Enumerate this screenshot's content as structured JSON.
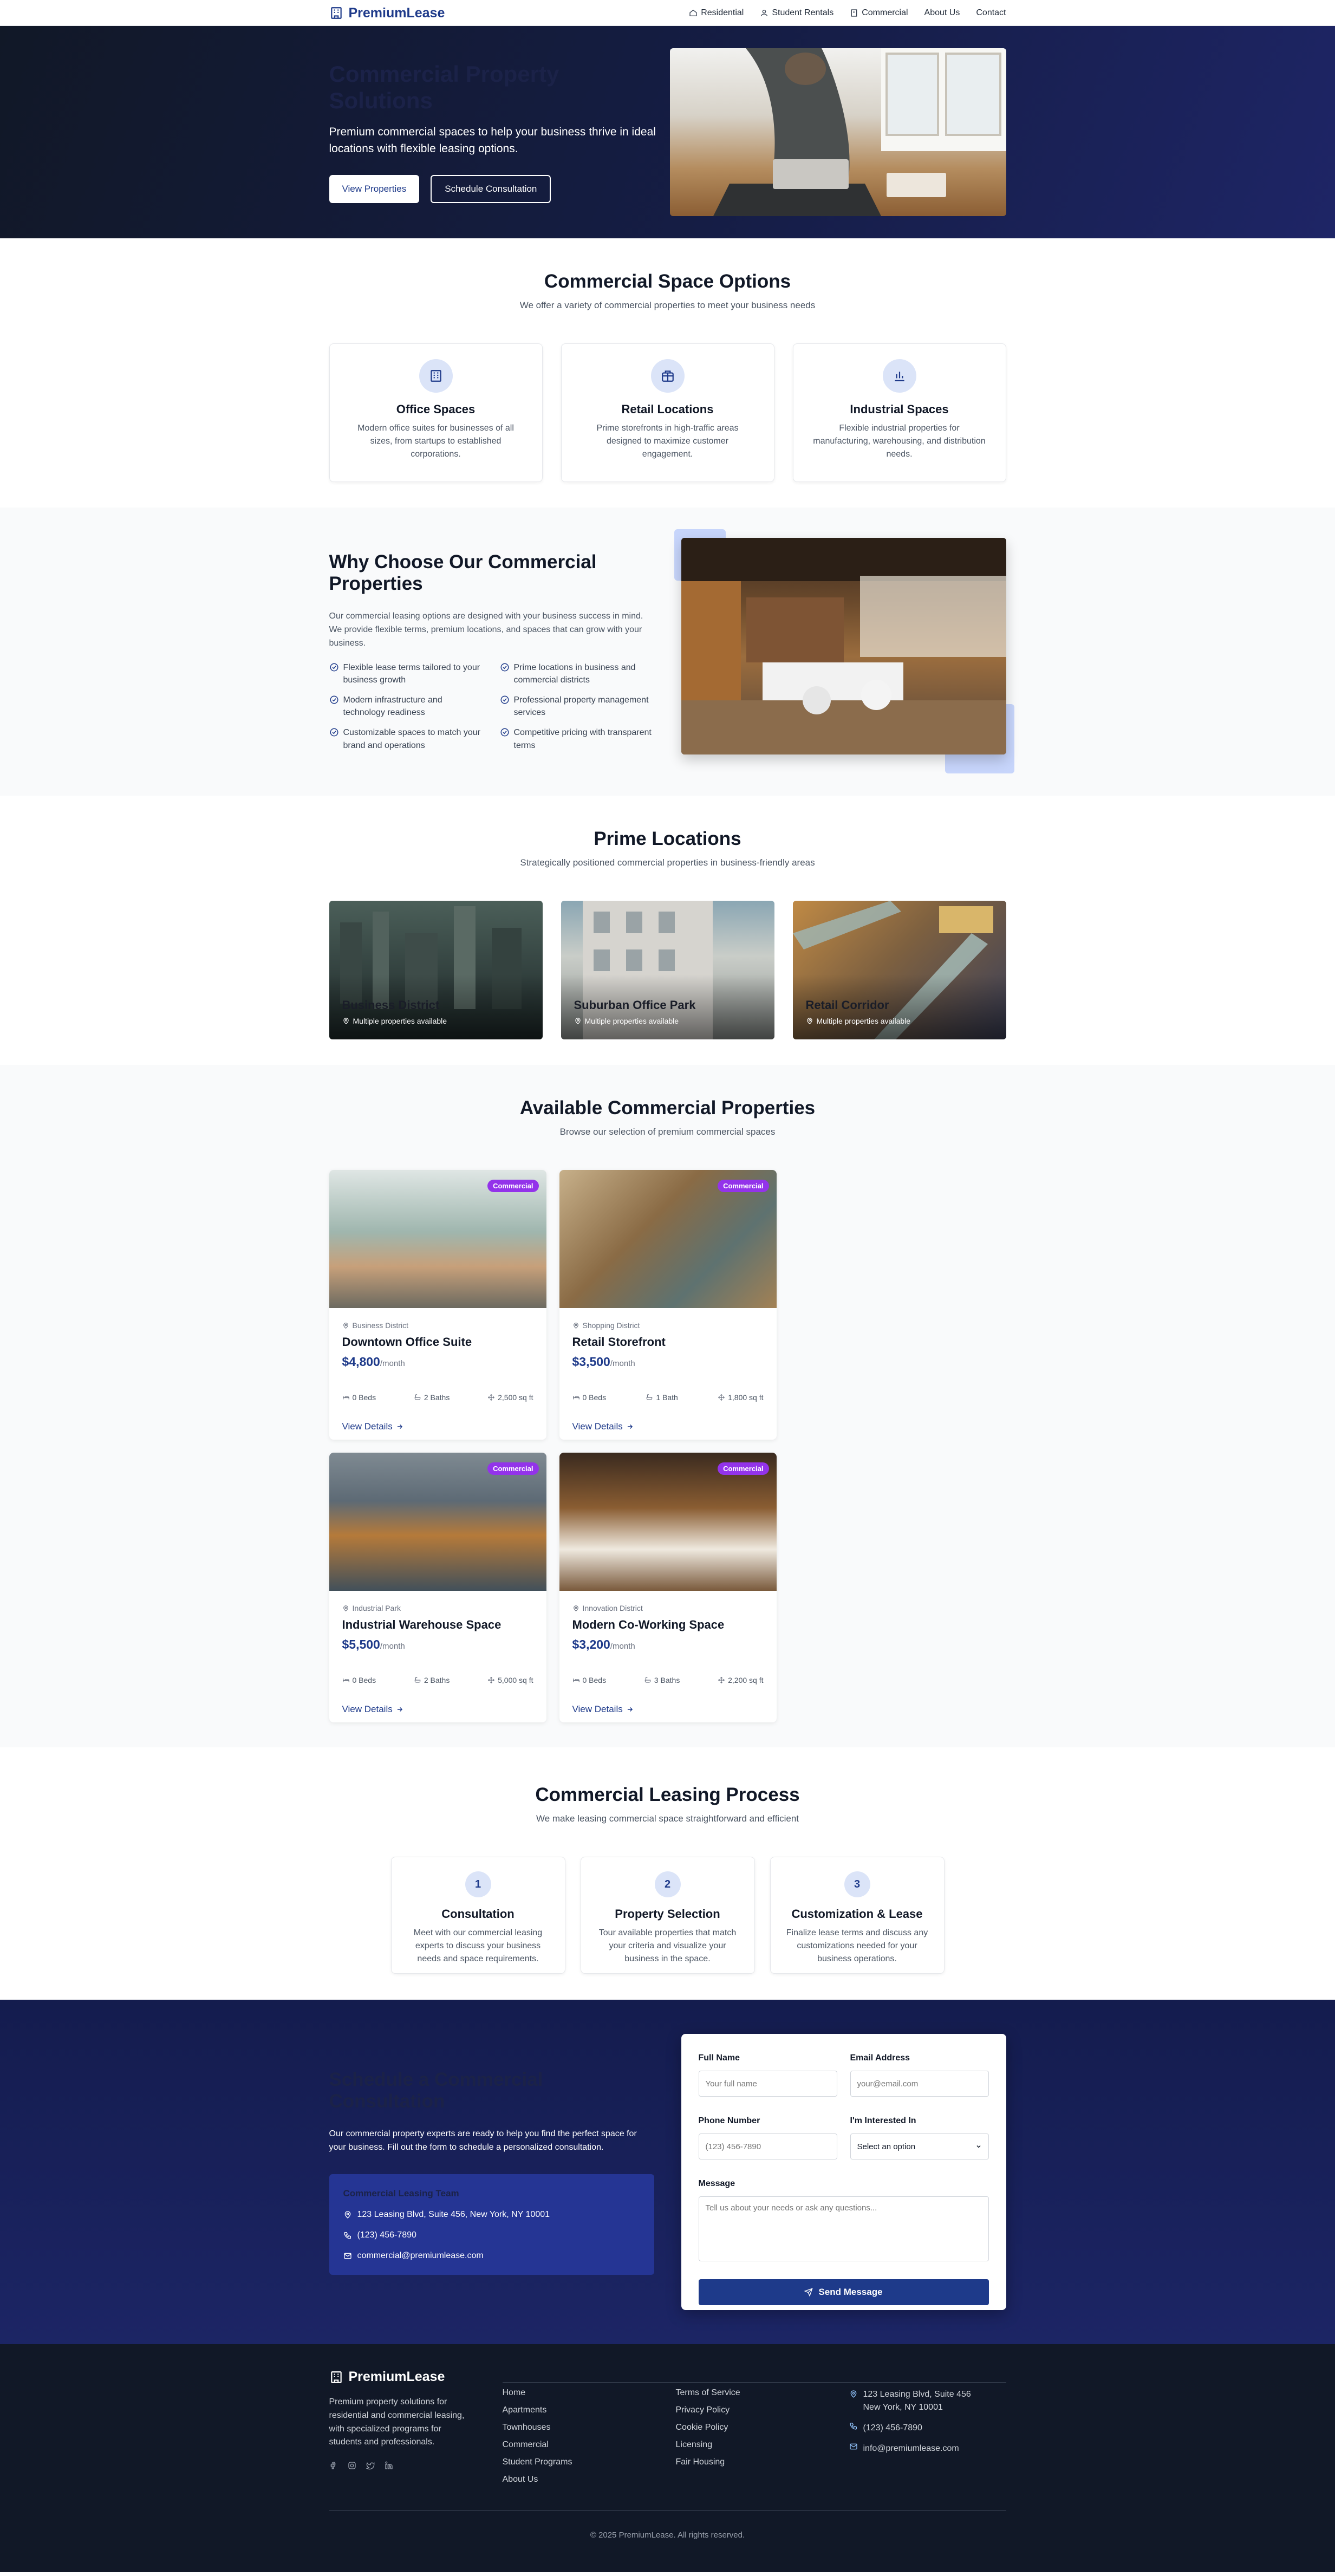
{
  "brand": "PremiumLease",
  "nav": [
    {
      "label": "Residential",
      "icon": "home-icon"
    },
    {
      "label": "Student Rentals",
      "icon": "user-icon"
    },
    {
      "label": "Commercial",
      "icon": "building-icon"
    },
    {
      "label": "About Us"
    },
    {
      "label": "Contact"
    }
  ],
  "hero": {
    "title": "Commercial Property Solutions",
    "subtitle": "Premium commercial spaces to help your business thrive in ideal locations with flexible leasing options.",
    "primary_button": "View Properties",
    "secondary_button": "Schedule Consultation"
  },
  "options": {
    "title": "Commercial Space Options",
    "subtitle": "We offer a variety of commercial properties to meet your business needs",
    "cards": [
      {
        "title": "Office Spaces",
        "desc": "Modern office suites for businesses of all sizes, from startups to established corporations.",
        "icon": "office-building-icon"
      },
      {
        "title": "Retail Locations",
        "desc": "Prime storefronts in high-traffic areas designed to maximize customer engagement.",
        "icon": "storefront-icon"
      },
      {
        "title": "Industrial Spaces",
        "desc": "Flexible industrial properties for manufacturing, warehousing, and distribution needs.",
        "icon": "bar-chart-icon"
      }
    ]
  },
  "why": {
    "title": "Why Choose Our Commercial Properties",
    "desc": "Our commercial leasing options are designed with your business success in mind. We provide flexible terms, premium locations, and spaces that can grow with your business.",
    "features": [
      "Flexible lease terms tailored to your business growth",
      "Prime locations in business and commercial districts",
      "Modern infrastructure and technology readiness",
      "Professional property management services",
      "Customizable spaces to match your brand and operations",
      "Competitive pricing with transparent terms"
    ]
  },
  "locations": {
    "title": "Prime Locations",
    "subtitle": "Strategically positioned commercial properties in business-friendly areas",
    "items": [
      {
        "name": "Business District",
        "meta": "Multiple properties available"
      },
      {
        "name": "Suburban Office Park",
        "meta": "Multiple properties available"
      },
      {
        "name": "Retail Corridor",
        "meta": "Multiple properties available"
      }
    ]
  },
  "properties": {
    "title": "Available Commercial Properties",
    "subtitle": "Browse our selection of premium commercial spaces",
    "badge": "Commercial",
    "link_label": "View Details",
    "price_unit": "/month",
    "items": [
      {
        "location": "Business District",
        "name": "Downtown Office Suite",
        "price": "$4,800",
        "beds": "0 Beds",
        "baths": "2 Baths",
        "area": "2,500 sq ft"
      },
      {
        "location": "Shopping District",
        "name": "Retail Storefront",
        "price": "$3,500",
        "beds": "0 Beds",
        "baths": "1 Bath",
        "area": "1,800 sq ft"
      },
      {
        "location": "Industrial Park",
        "name": "Industrial Warehouse Space",
        "price": "$5,500",
        "beds": "0 Beds",
        "baths": "2 Baths",
        "area": "5,000 sq ft"
      },
      {
        "location": "Innovation District",
        "name": "Modern Co-Working Space",
        "price": "$3,200",
        "beds": "0 Beds",
        "baths": "3 Baths",
        "area": "2,200 sq ft"
      }
    ]
  },
  "process": {
    "title": "Commercial Leasing Process",
    "subtitle": "We make leasing commercial space straightforward and efficient",
    "steps": [
      {
        "num": "1",
        "title": "Consultation",
        "desc": "Meet with our commercial leasing experts to discuss your business needs and space requirements."
      },
      {
        "num": "2",
        "title": "Property Selection",
        "desc": "Tour available properties that match your criteria and visualize your business in the space."
      },
      {
        "num": "3",
        "title": "Customization & Lease",
        "desc": "Finalize lease terms and discuss any customizations needed for your business operations."
      }
    ]
  },
  "contact": {
    "title": "Schedule a Commercial Consultation",
    "desc": "Our commercial property experts are ready to help you find the perfect space for your business. Fill out the form to schedule a personalized consultation.",
    "box_title": "Commercial Leasing Team",
    "address": "123 Leasing Blvd, Suite 456, New York, NY 10001",
    "phone": "(123) 456-7890",
    "email": "commercial@premiumlease.com",
    "form": {
      "name_label": "Full Name",
      "name_placeholder": "Your full name",
      "email_label": "Email Address",
      "email_placeholder": "your@email.com",
      "phone_label": "Phone Number",
      "phone_placeholder": "(123) 456-7890",
      "interest_label": "I'm Interested In",
      "interest_value": "Select an option",
      "message_label": "Message",
      "message_placeholder": "Tell us about your needs or ask any questions...",
      "submit": "Send Message"
    }
  },
  "footer": {
    "about": "Premium property solutions for residential and commercial leasing, with specialized programs for students and professionals.",
    "links1": [
      "Home",
      "Apartments",
      "Townhouses",
      "Commercial",
      "Student Programs",
      "About Us"
    ],
    "links2": [
      "Terms of Service",
      "Privacy Policy",
      "Cookie Policy",
      "Licensing",
      "Fair Housing"
    ],
    "address": "123 Leasing Blvd, Suite 456 New York, NY 10001",
    "phone": "(123) 456-7890",
    "email": "info@premiumlease.com",
    "copyright": "© 2025 PremiumLease. All rights reserved.",
    "social": [
      "facebook-icon",
      "instagram-icon",
      "twitter-icon",
      "linkedin-icon"
    ]
  },
  "colors": {
    "primary": "#1e3a8a",
    "badge": "#9333ea",
    "hero_bg": "#151d45",
    "footer_bg": "#111827"
  }
}
